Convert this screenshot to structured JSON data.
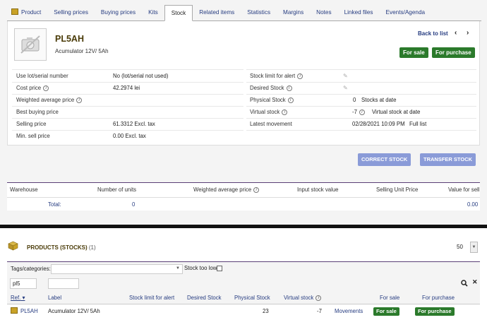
{
  "tabs": [
    "Product",
    "Buying prices",
    "Selling prices",
    "Kits",
    "Stock",
    "Related items",
    "Statistics",
    "Margins",
    "Notes",
    "Linked files",
    "Events/Agenda"
  ],
  "tabs_display": [
    "Product",
    "Selling prices",
    "Buying prices",
    "Kits",
    "Stock",
    "Related items",
    "Statistics",
    "Margins",
    "Notes",
    "Linked files",
    "Events/Agenda"
  ],
  "active_tab": "Stock",
  "product": {
    "ref": "PL5AH",
    "label": "Acumulator 12V/ 5Ah",
    "back_to_list": "Back to list",
    "for_sale": "For sale",
    "for_purchase": "For purchase"
  },
  "left_fields": [
    {
      "label": "Use lot/serial number",
      "value": "No (lot/serial not used)",
      "info": false
    },
    {
      "label": "Cost price",
      "value": "42.2974 lei",
      "info": true
    },
    {
      "label": "Weighted average price",
      "value": "",
      "info": true
    },
    {
      "label": "Best buying price",
      "value": "",
      "info": false
    },
    {
      "label": "Selling price",
      "value": "61.3312 Excl. tax",
      "info": false
    },
    {
      "label": "Min. sell price",
      "value": "0.00 Excl. tax",
      "info": false
    }
  ],
  "right_fields": [
    {
      "label": "Stock limit for alert",
      "value": "",
      "link": "",
      "info": true
    },
    {
      "label": "Desired Stock",
      "value": "",
      "link": "",
      "info": true
    },
    {
      "label": "Physical Stock",
      "value": "0",
      "link": "Stocks at date",
      "info": true
    },
    {
      "label": "Virtual stock",
      "value": "-7",
      "link": "Virtual stock at date",
      "info": true
    },
    {
      "label": "Latest movement",
      "value": "02/28/2021 10:09 PM",
      "link": "Full list",
      "info": false
    }
  ],
  "actions": {
    "correct": "CORRECT STOCK",
    "transfer": "TRANSFER STOCK"
  },
  "warehouse_table": {
    "headers": [
      "Warehouse",
      "Number of units",
      "Weighted average price",
      "Input stock value",
      "Selling Unit Price",
      "Value for sell"
    ],
    "total_label": "Total:",
    "total_units": "0",
    "total_value": "0.00"
  },
  "products_list": {
    "title": "PRODUCTS (STOCKS)",
    "count": "(1)",
    "per_page": "50",
    "tags_label": "Tags/categories:",
    "stock_too_low": "Stock too low",
    "search_ref": "pl5",
    "headers": [
      "Ref.",
      "Label",
      "Stock limit for alert",
      "Desired Stock",
      "Physical Stock",
      "Virtual stock",
      "For sale",
      "For purchase"
    ],
    "rows": [
      {
        "ref": "PL5AH",
        "label": "Acumulator 12V/ 5Ah",
        "physical": "23",
        "virtual": "-7",
        "movements": "Movements",
        "for_sale": "For sale",
        "for_purchase": "For purchase"
      }
    ]
  },
  "colors": {
    "link": "#263c80",
    "green": "#2b7a2b",
    "action": "#8a9bd8",
    "title": "#4a3b08"
  }
}
